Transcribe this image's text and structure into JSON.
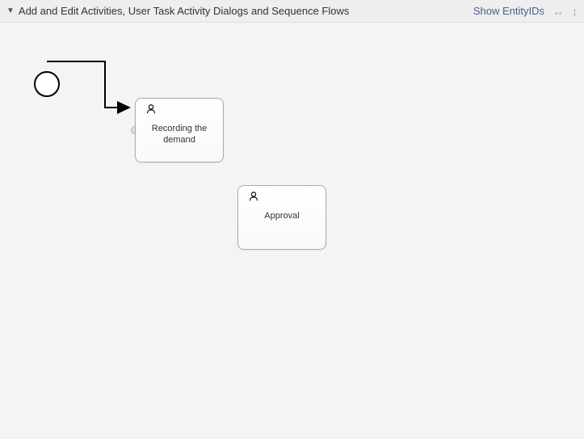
{
  "header": {
    "title": "Add and Edit Activities, User Task Activity Dialogs and Sequence Flows",
    "show_entity_label": "Show EntityIDs"
  },
  "diagram": {
    "start_event_name": "start-event",
    "activities": [
      {
        "label": "Recording the demand"
      },
      {
        "label": "Approval"
      }
    ]
  }
}
